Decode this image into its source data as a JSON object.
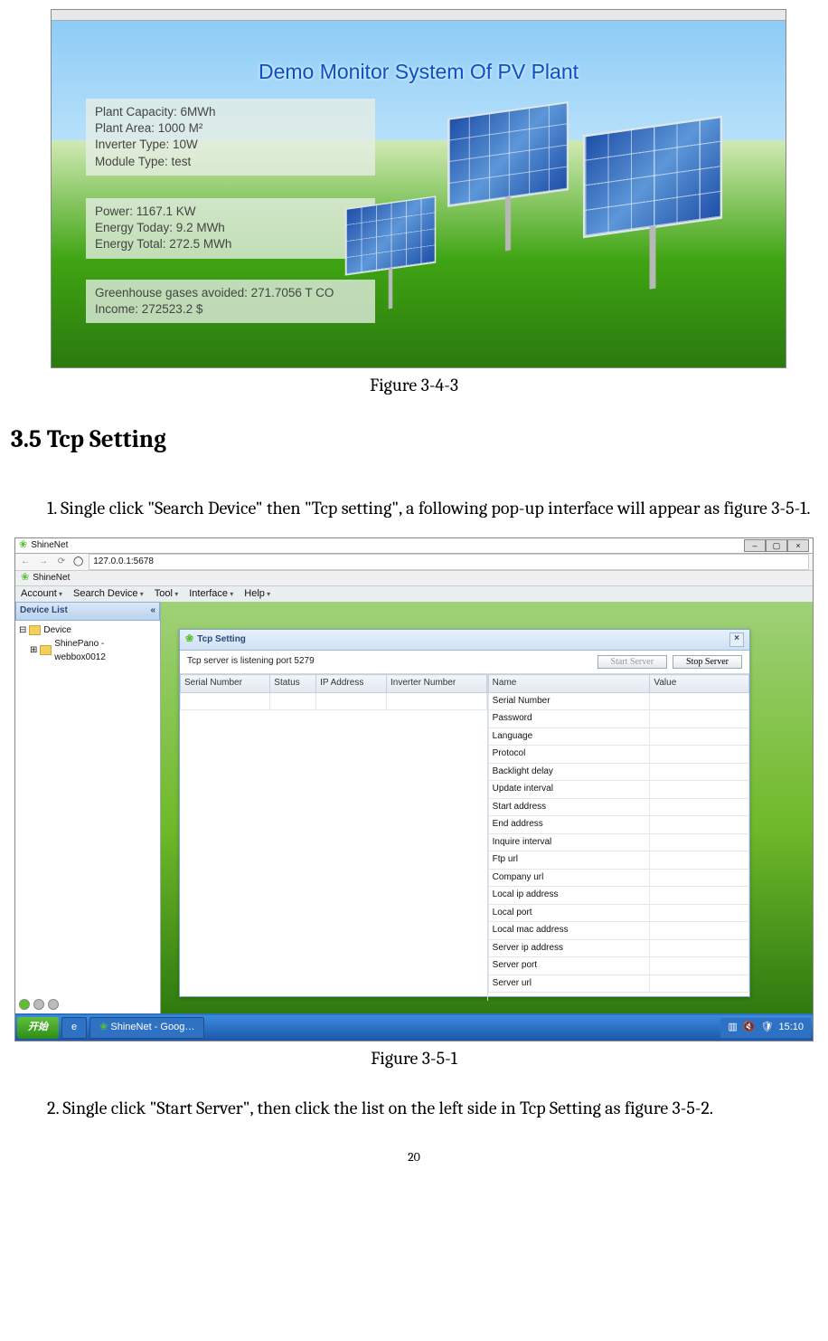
{
  "fig1": {
    "title": "Demo Monitor System Of PV Plant",
    "box1": {
      "l1": "Plant Capacity: 6MWh",
      "l2": "Plant Area: 1000 M²",
      "l3": "Inverter Type: 10W",
      "l4": "Module Type: test"
    },
    "box2": {
      "l1": "Power: 1167.1 KW",
      "l2": "Energy Today: 9.2 MWh",
      "l3": "Energy Total: 272.5 MWh"
    },
    "box3": {
      "l1": "Greenhouse gases avoided: 271.7056 T CO",
      "l2": "Income: 272523.2 $"
    },
    "caption": "Figure 3-4-3"
  },
  "section_heading": "3.5 Tcp Setting",
  "para1": "1. Single click \"Search Device\" then \"Tcp setting\", a following pop-up interface will appear as figure 3-5-1.",
  "fig2": {
    "wintitle": "ShineNet",
    "url": "127.0.0.1:5678",
    "tab": "ShineNet",
    "menu": {
      "m1": "Account",
      "m2": "Search Device",
      "m3": "Tool",
      "m4": "Interface",
      "m5": "Help"
    },
    "sidebar": {
      "title": "Device List",
      "collapse": "«",
      "node1": "Device",
      "node2": "ShinePano - webbox0012"
    },
    "tcp": {
      "title": "Tcp Setting",
      "listening": "Tcp server is listening port 5279",
      "start": "Start Server",
      "stop": "Stop Server",
      "colA": "Serial Number",
      "colB": "Status",
      "colC": "IP Address",
      "colD": "Inverter Number",
      "colName": "Name",
      "colValue": "Value",
      "props": [
        "Serial Number",
        "Password",
        "Language",
        "Protocol",
        "Backlight delay",
        "Update interval",
        "Start address",
        "End address",
        "Inquire interval",
        "Ftp url",
        "Company url",
        "Local ip address",
        "Local port",
        "Local mac address",
        "Server ip address",
        "Server port",
        "Server url"
      ]
    },
    "taskbar": {
      "start": "开始",
      "task1": "ShineNet - Goog…",
      "time": "15:10"
    },
    "caption": "Figure 3-5-1"
  },
  "para2": "2. Single click \"Start Server\", then click the list on the left side in Tcp Setting as figure 3-5-2.",
  "pagenum": "20"
}
